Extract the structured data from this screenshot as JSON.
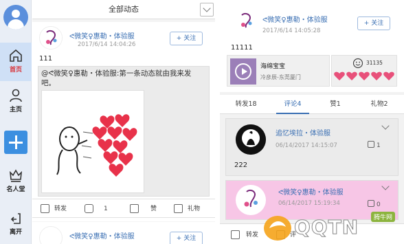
{
  "sidebar": {
    "items": [
      {
        "label": "首页",
        "icon": "home-icon",
        "active": true
      },
      {
        "label": "主页",
        "icon": "user-icon",
        "active": false
      },
      {
        "label": "",
        "icon": "add-icon",
        "active": false
      },
      {
        "label": "名人堂",
        "icon": "crown-icon",
        "active": false
      },
      {
        "label": "离开",
        "icon": "exit-icon",
        "active": false
      }
    ]
  },
  "feed": {
    "header_title": "全部动态",
    "post": {
      "author": "ᕙ微笑♀惠勒・体验服",
      "time": "2017/6/14  14:04:26",
      "follow_label": "+ 关注",
      "content": "111",
      "repost_text": "@ᕙ微笑♀惠勒・体验服:第一条动态就由我来发吧。",
      "actions": {
        "repost": "转发",
        "comment_count": "1",
        "like": "赞",
        "gift": "礼物"
      }
    },
    "next_post": {
      "author": "ᕙ微笑♀惠勒・体验服",
      "follow_label": "+ 关注"
    }
  },
  "detail": {
    "author": "ᕙ微笑♀惠勒・体验服",
    "time": "2017/6/14  14:05:28",
    "follow_label": "+ 关注",
    "content": "11111",
    "music": {
      "title": "海绵宝宝",
      "artist": "冷彦辰-东莞厦门"
    },
    "gift_count": "31135",
    "tabs": {
      "repost": "转发18",
      "comment": "评论4",
      "like": "赞1",
      "gift": "礼物2"
    },
    "comments": [
      {
        "author": "追忆埃拉・体验服",
        "time": "06/14/2017  14:15:07",
        "likes": "1",
        "text": "222"
      },
      {
        "author": "ᕙ微笑♀惠勒・体验服",
        "time": "06/14/2017  15:19:34",
        "likes": "0"
      }
    ],
    "bottom_actions": {
      "repost": "转发",
      "comment": "评"
    }
  },
  "watermark": {
    "brand": "QQTN",
    "domain": "com",
    "badge": "腾牛网"
  },
  "colors": {
    "accent": "#3a6fb3",
    "active_nav": "#d9343a",
    "add_button": "#3c8fe0",
    "heart": "#e8324a",
    "pink_card": "#f7c6e6"
  }
}
